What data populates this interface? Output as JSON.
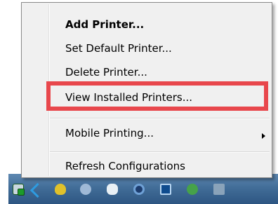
{
  "menu": {
    "items": [
      {
        "label": "Add Printer...",
        "bold": true
      },
      {
        "label": "Set Default Printer...",
        "bold": false
      },
      {
        "label": "Delete Printer...",
        "bold": false
      },
      {
        "label": "View Installed Printers...",
        "bold": false,
        "highlighted": true
      },
      {
        "label": "Mobile Printing...",
        "bold": false,
        "has_submenu": true
      },
      {
        "label": "Refresh Configurations",
        "bold": false
      }
    ]
  },
  "highlight": {
    "color": "#e8474c"
  },
  "taskbar": {
    "icons": [
      "printer-tray-icon",
      "arrow-icon",
      "shield-icon",
      "globe-icon",
      "chat-bubble-icon",
      "disc-icon",
      "monitor-icon",
      "checkmark-icon",
      "network-signal-icon"
    ]
  }
}
